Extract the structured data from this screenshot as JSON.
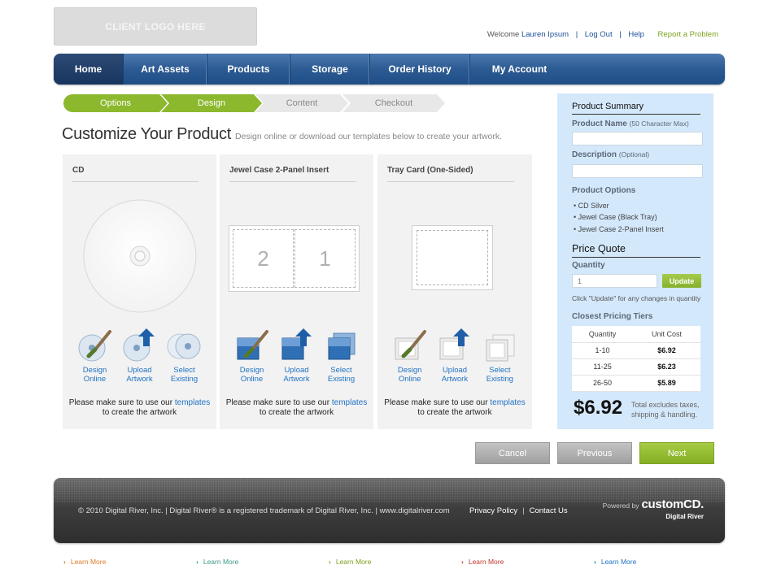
{
  "header": {
    "logo_text": "CLIENT LOGO HERE",
    "welcome": "Welcome",
    "user_name": "Lauren Ipsum",
    "logout": "Log Out",
    "help": "Help",
    "report": "Report a Problem"
  },
  "nav": {
    "items": [
      {
        "label": "Home",
        "active": true
      },
      {
        "label": "Art Assets"
      },
      {
        "label": "Products"
      },
      {
        "label": "Storage"
      },
      {
        "label": "Order History"
      },
      {
        "label": "My Account"
      }
    ]
  },
  "steps": [
    "Options",
    "Design",
    "Content",
    "Checkout"
  ],
  "page": {
    "title": "Customize Your Product",
    "subtitle": "Design online or download our templates below to create your artwork."
  },
  "panels": [
    {
      "title": "CD",
      "actions": [
        [
          "Design",
          "Online"
        ],
        [
          "Upload",
          "Artwork"
        ],
        [
          "Select",
          "Existing"
        ]
      ],
      "note_pre": "Please make sure to use our",
      "note_link": "templates",
      "note_post": "to create the artwork"
    },
    {
      "title": "Jewel Case 2-Panel Insert",
      "actions": [
        [
          "Design",
          "Online"
        ],
        [
          "Upload",
          "Artwork"
        ],
        [
          "Select",
          "Existing"
        ]
      ],
      "panel_numbers": [
        "2",
        "1"
      ],
      "note_pre": "Please make sure to use our",
      "note_link": "templates",
      "note_post": "to create the artwork"
    },
    {
      "title": "Tray Card (One-Sided)",
      "actions": [
        [
          "Design",
          "Online"
        ],
        [
          "Upload",
          "Artwork"
        ],
        [
          "Select",
          "Existing"
        ]
      ],
      "note_pre": "Please make sure to use our",
      "note_link": "templates",
      "note_post": "to create the artwork"
    }
  ],
  "summary": {
    "title": "Product Summary",
    "product_name_label": "Product Name",
    "product_name_hint": "(50 Character Max)",
    "description_label": "Description",
    "description_hint": "(Optional)",
    "options_label": "Product Options",
    "options": [
      "• CD Silver",
      "• Jewel Case (Black Tray)",
      "• Jewel Case 2-Panel Insert"
    ],
    "quote_title": "Price Quote",
    "quantity_label": "Quantity",
    "quantity_value": "1",
    "update_label": "Update",
    "update_hint": "Click \"Update\" for any changes in quantity",
    "tiers_label": "Closest Pricing Tiers",
    "tiers_header": [
      "Quantity",
      "Unit Cost"
    ],
    "tiers": [
      [
        "1-10",
        "$6.92"
      ],
      [
        "11-25",
        "$6.23"
      ],
      [
        "26-50",
        "$5.89"
      ]
    ],
    "total_price": "$6.92",
    "total_note_1": "Total excludes taxes,",
    "total_note_2": "shipping & handling."
  },
  "buttons": {
    "cancel": "Cancel",
    "previous": "Previous",
    "next": "Next"
  },
  "footer": {
    "copyright": "© 2010 Digital River, Inc. | Digital River® is a registered trademark of Digital River, Inc. | www.digitalriver.com",
    "privacy": "Privacy Policy",
    "contact": "Contact Us",
    "powered_by": "Powered by",
    "brand": "customCD.",
    "brand_sub": "Digital River"
  },
  "learn_more": {
    "label": "Learn More",
    "colors": [
      "#e07b2a",
      "#3b9a8a",
      "#7aa21b",
      "#c0392b",
      "#1f72c4"
    ]
  },
  "colors": {
    "nav_blue": "#2c5a92",
    "accent_green": "#8cb82e",
    "link_blue": "#1f72c4",
    "summary_bg": "#d4e8fb"
  }
}
